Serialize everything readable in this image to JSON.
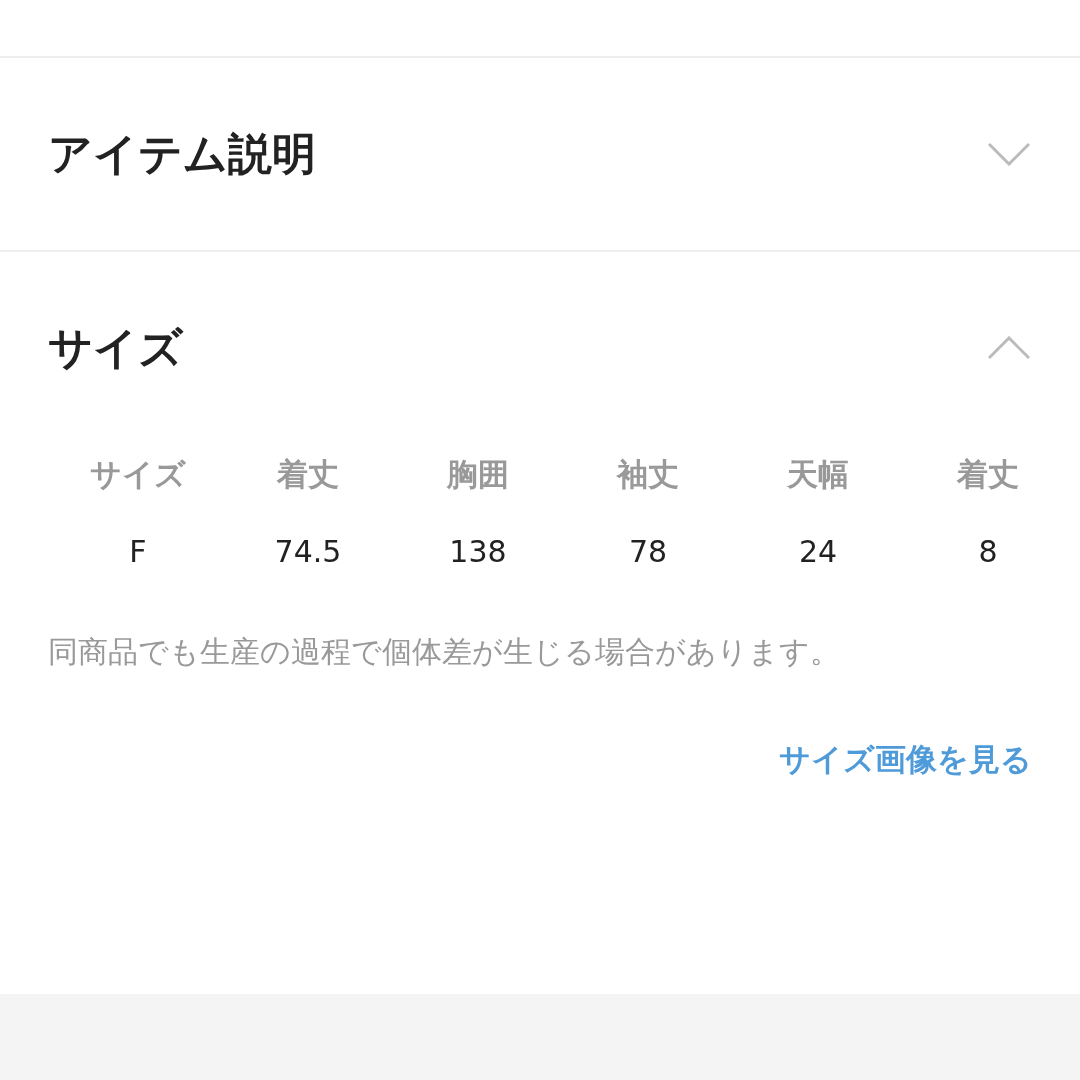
{
  "sections": [
    {
      "title": "アイテム説明",
      "expanded": false
    },
    {
      "title": "サイズ",
      "expanded": true,
      "table": {
        "columns": [
          "サイズ",
          "着丈",
          "胸囲",
          "袖丈",
          "天幅",
          "着丈"
        ],
        "rows": [
          [
            "F",
            "74.5",
            "138",
            "78",
            "24",
            "8"
          ]
        ]
      },
      "note": "同商品でも生産の過程で個体差が生じる場合があります。",
      "link": "サイズ画像を見る"
    }
  ]
}
